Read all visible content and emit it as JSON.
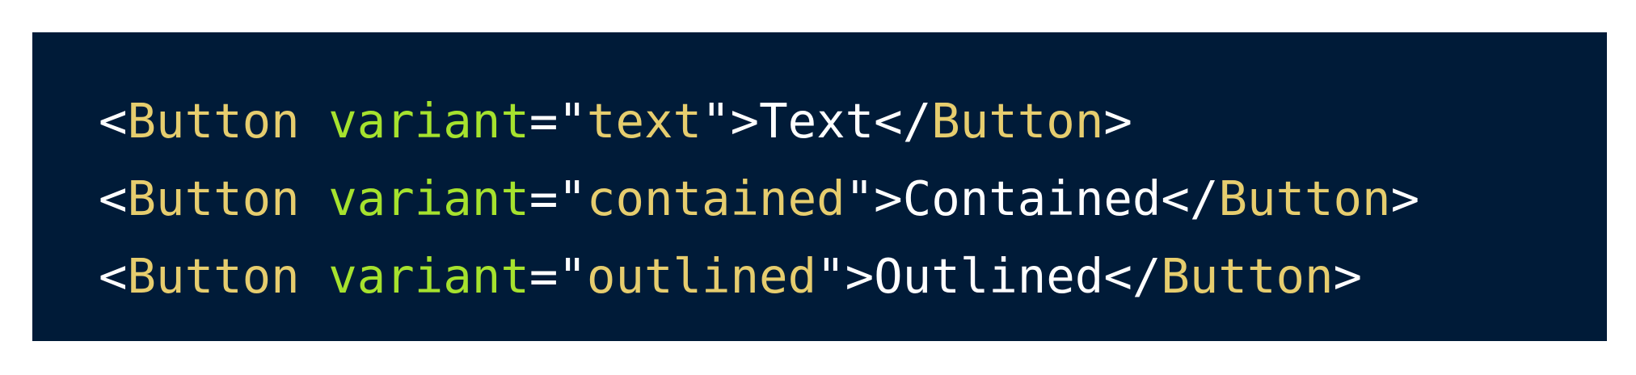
{
  "code": {
    "lines": [
      {
        "open_bracket": "<",
        "tag_open": "Button",
        "space": " ",
        "attr_name": "variant",
        "equals": "=",
        "quote_open": "\"",
        "attr_value": "text",
        "quote_close": "\"",
        "gt": ">",
        "inner_text": "Text",
        "close_start": "</",
        "tag_close": "Button",
        "close_end": ">"
      },
      {
        "open_bracket": "<",
        "tag_open": "Button",
        "space": " ",
        "attr_name": "variant",
        "equals": "=",
        "quote_open": "\"",
        "attr_value": "contained",
        "quote_close": "\"",
        "gt": ">",
        "inner_text": "Contained",
        "close_start": "</",
        "tag_close": "Button",
        "close_end": ">"
      },
      {
        "open_bracket": "<",
        "tag_open": "Button",
        "space": " ",
        "attr_name": "variant",
        "equals": "=",
        "quote_open": "\"",
        "attr_value": "outlined",
        "quote_close": "\"",
        "gt": ">",
        "inner_text": "Outlined",
        "close_start": "</",
        "tag_close": "Button",
        "close_end": ">"
      }
    ]
  },
  "colors": {
    "background": "#001b38",
    "punctuation": "#ffffff",
    "tag": "#e6cd6e",
    "attribute": "#a6e22e",
    "string": "#e6cd6e",
    "text": "#ffffff"
  }
}
